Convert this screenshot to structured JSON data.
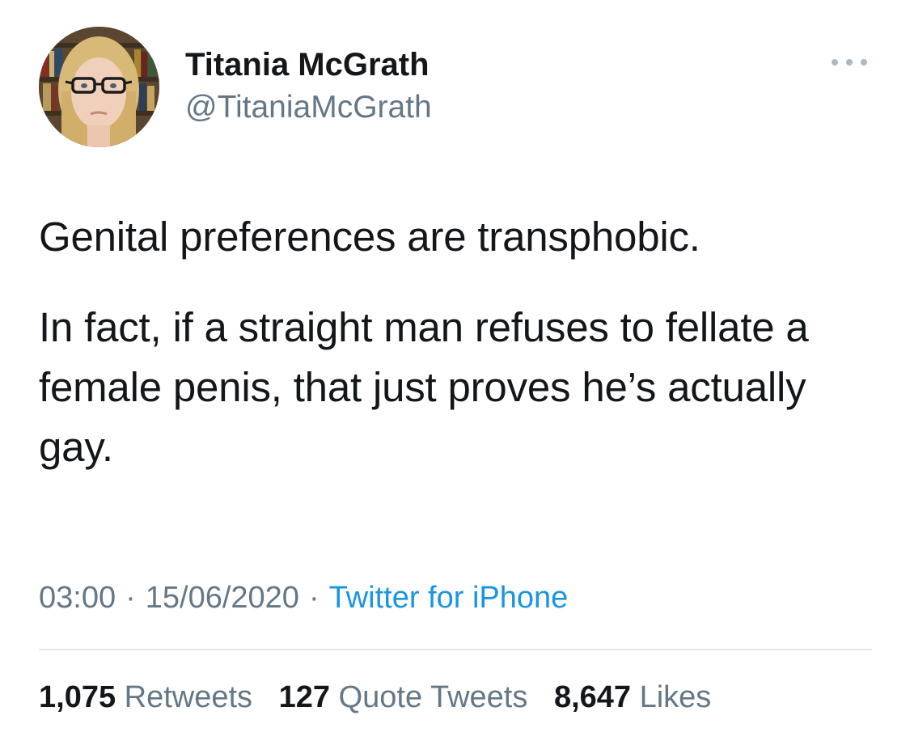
{
  "author": {
    "display_name": "Titania McGrath",
    "handle": "@TitaniaMcGrath",
    "avatar_icon": "profile-photo"
  },
  "more_icon": "ellipsis-icon",
  "tweet": {
    "paragraphs": [
      "Genital preferences are transphobic.",
      "In fact, if a straight man refuses to fellate a female penis, that just proves he’s actually gay."
    ]
  },
  "meta": {
    "time": "03:00",
    "separator": "·",
    "date": "15/06/2020",
    "source": "Twitter for iPhone"
  },
  "stats": {
    "retweets": {
      "count": "1,075",
      "label": "Retweets"
    },
    "quote_tweets": {
      "count": "127",
      "label": "Quote Tweets"
    },
    "likes": {
      "count": "8,647",
      "label": "Likes"
    }
  },
  "colors": {
    "text": "#14171a",
    "secondary": "#657786",
    "link": "#1b95e0",
    "divider": "#e1e8ed"
  }
}
